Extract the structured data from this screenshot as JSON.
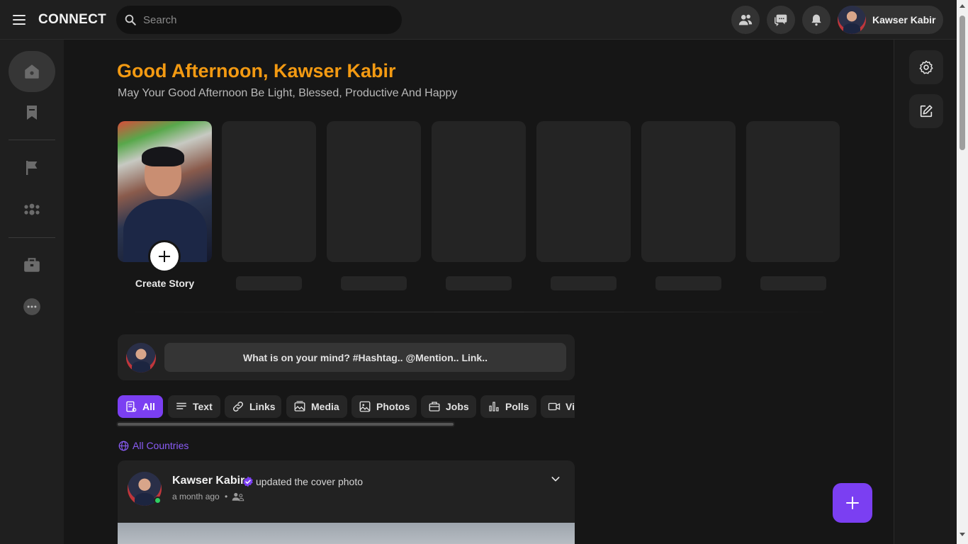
{
  "app": {
    "brand": "CONNECT"
  },
  "search": {
    "placeholder": "Search"
  },
  "user": {
    "name": "Kawser Kabir"
  },
  "greeting": {
    "title": "Good Afternoon, Kawser Kabir",
    "subtitle": "May Your Good Afternoon Be Light, Blessed, Productive And Happy"
  },
  "stories": {
    "create_label": "Create Story"
  },
  "composer": {
    "placeholder": "What is on your mind? #Hashtag.. @Mention.. Link.."
  },
  "filters": [
    {
      "label": "All",
      "icon": "feed-icon"
    },
    {
      "label": "Text",
      "icon": "text-icon"
    },
    {
      "label": "Links",
      "icon": "link-icon"
    },
    {
      "label": "Media",
      "icon": "media-icon"
    },
    {
      "label": "Photos",
      "icon": "photo-icon"
    },
    {
      "label": "Jobs",
      "icon": "briefcase-icon"
    },
    {
      "label": "Polls",
      "icon": "bar-chart-icon"
    },
    {
      "label": "Vi",
      "icon": "video-icon"
    }
  ],
  "country_filter": {
    "label": "All Countries"
  },
  "post": {
    "author": "Kawser Kabir",
    "action": "updated the cover photo",
    "time": "a month ago",
    "separator": "•"
  },
  "colors": {
    "accent": "#7b3ff2",
    "greeting": "#f39a12",
    "online": "#2fcf62"
  }
}
